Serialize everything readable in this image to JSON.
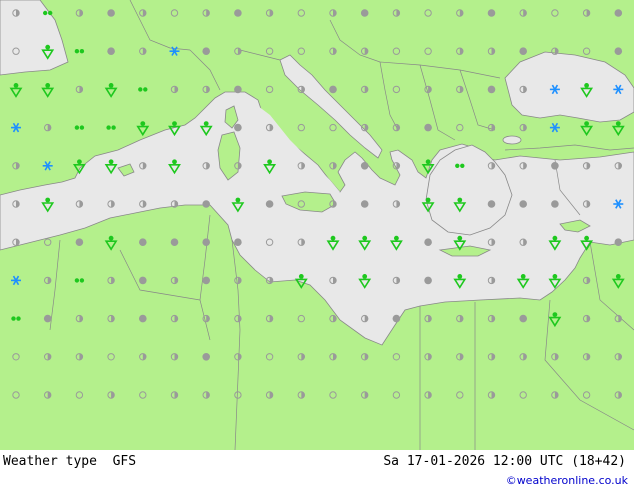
{
  "map": {
    "colors": {
      "land": "#b4f08c",
      "sea": "#e8e8e8",
      "border": "#888888",
      "cloud_dot": "#9a9a9a",
      "rain": "#1ec81e",
      "snow": "#1e90ff"
    },
    "legend_symbols": [
      "open-circle-clear",
      "half-circle-partly-cloudy",
      "filled-dot-cloudy",
      "rain-shower-icon",
      "drizzle-icon",
      "snow-icon"
    ]
  },
  "footer": {
    "left_label": "Weather type  GFS",
    "datetime": "Sa 17-01-2026 12:00 UTC (18+42)",
    "credit": "©weatheronline.co.uk"
  }
}
